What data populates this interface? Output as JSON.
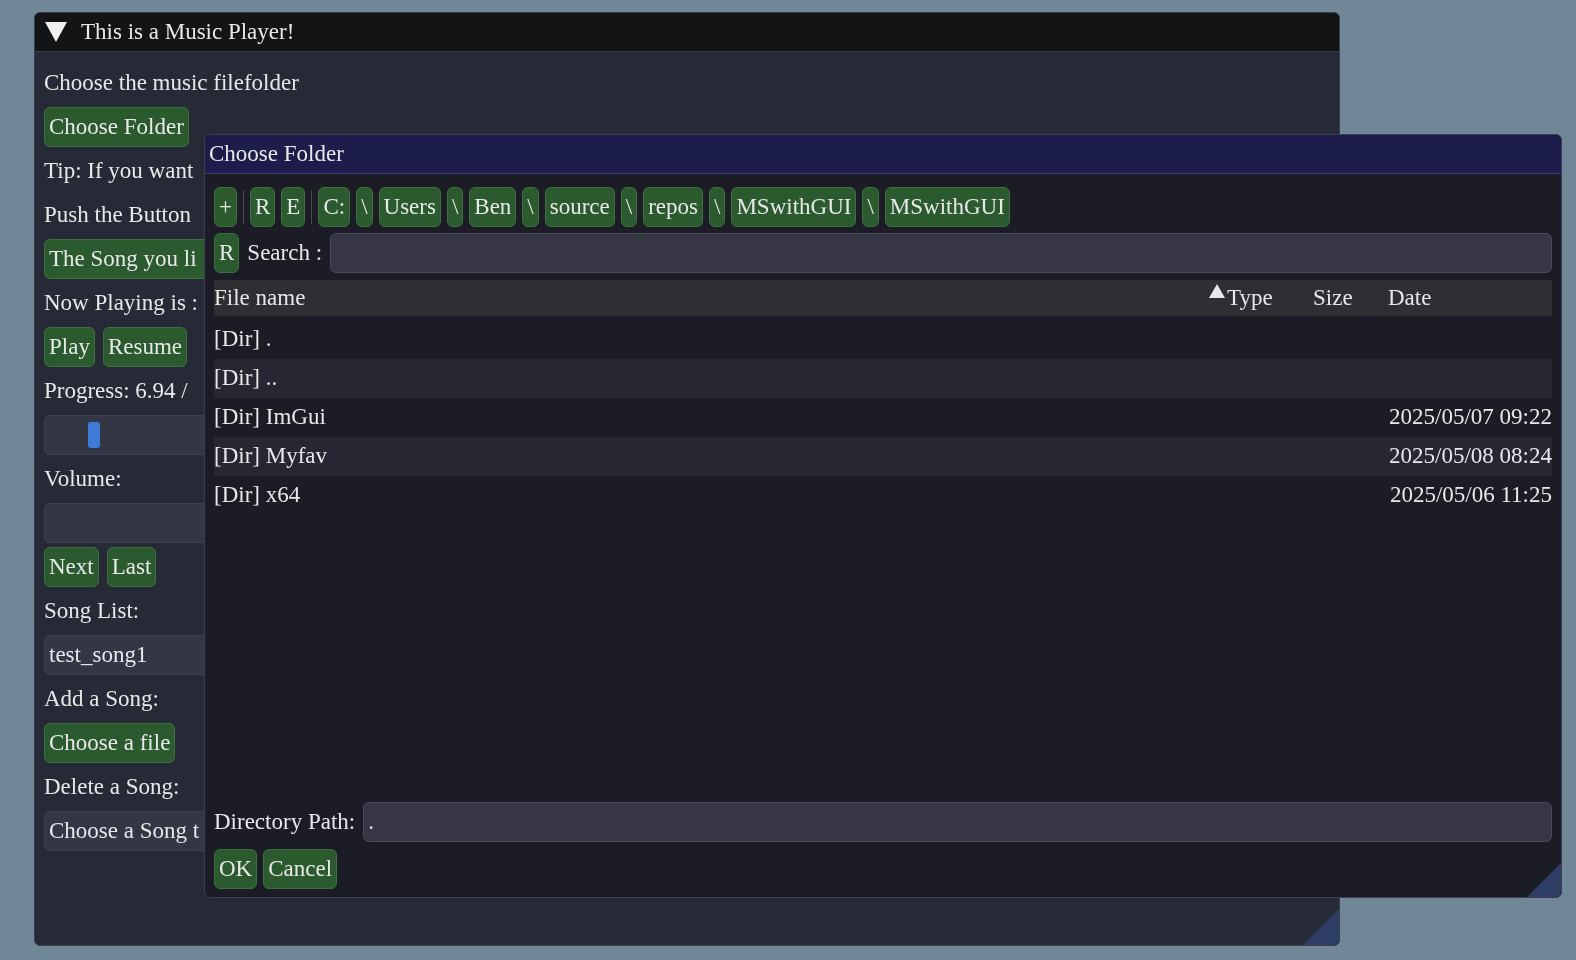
{
  "main_window": {
    "title": "This is a Music Player!",
    "expanded": true,
    "items": [
      {
        "kind": "text",
        "text": "Choose the music filefolder"
      },
      {
        "kind": "buttons",
        "buttons": [
          "Choose Folder"
        ]
      },
      {
        "kind": "text",
        "text": "Tip: If you want"
      },
      {
        "kind": "text",
        "text": "Push the Button"
      },
      {
        "kind": "wide_button",
        "buttons": [
          "The Song you li"
        ]
      },
      {
        "kind": "text",
        "text": "Now Playing is :"
      },
      {
        "kind": "buttons",
        "buttons": [
          "Play",
          "Resume"
        ]
      },
      {
        "kind": "text",
        "text": "Progress: 6.94 /"
      },
      {
        "kind": "slider",
        "level": 0.058
      },
      {
        "kind": "text",
        "text": "Volume:"
      },
      {
        "kind": "slider"
      },
      {
        "kind": "buttons",
        "buttons": [
          "Next",
          "Last"
        ]
      },
      {
        "kind": "text",
        "text": "Song List:"
      },
      {
        "kind": "combo",
        "value": "test_song1"
      },
      {
        "kind": "text",
        "text": "Add a Song:"
      },
      {
        "kind": "buttons",
        "buttons": [
          "Choose a file"
        ]
      },
      {
        "kind": "text",
        "text": "Delete a Song:"
      },
      {
        "kind": "combo",
        "value": "Choose a Song t"
      }
    ]
  },
  "dialog": {
    "title": "Choose Folder",
    "toolbar": [
      {
        "kind": "button",
        "label": "+"
      },
      {
        "kind": "separator"
      },
      {
        "kind": "button",
        "label": "R"
      },
      {
        "kind": "button",
        "label": "E"
      },
      {
        "kind": "separator"
      },
      {
        "kind": "button",
        "label": "C:"
      },
      {
        "kind": "button",
        "label": "\\"
      },
      {
        "kind": "button",
        "label": "Users"
      },
      {
        "kind": "button",
        "label": "\\"
      },
      {
        "kind": "button",
        "label": "Ben"
      },
      {
        "kind": "button",
        "label": "\\"
      },
      {
        "kind": "button",
        "label": "source"
      },
      {
        "kind": "button",
        "label": "\\"
      },
      {
        "kind": "button",
        "label": "repos"
      },
      {
        "kind": "button",
        "label": "\\"
      },
      {
        "kind": "button",
        "label": "MSwithGUI"
      },
      {
        "kind": "button",
        "label": "\\"
      },
      {
        "kind": "button",
        "label": "MSwithGUI"
      }
    ],
    "reset_button": "R",
    "search_label": "Search :",
    "table": {
      "columns": [
        "File name",
        "Type",
        "Size",
        "Date"
      ],
      "sort_ascending": true,
      "rows": [
        {
          "name": "[Dir] ."
        },
        {
          "name": "[Dir] .."
        },
        {
          "name": "[Dir] ImGui",
          "date": "2025/05/07 09:22"
        },
        {
          "name": "[Dir] Myfav",
          "date": "2025/05/08 08:24"
        },
        {
          "name": "[Dir] x64",
          "date": "2025/05/06 11:25"
        }
      ]
    },
    "path_label": "Directory Path:",
    "path_value": ".",
    "buttons": [
      "OK",
      "Cancel"
    ]
  }
}
